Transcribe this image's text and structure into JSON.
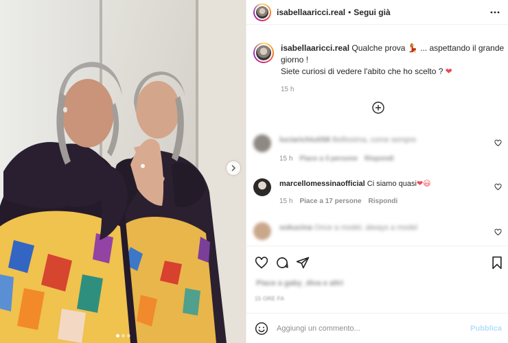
{
  "header": {
    "username": "isabellaaricci.real",
    "separator": "•",
    "follow_label": "Segui già",
    "more_icon": "more-horizontal-icon"
  },
  "caption": {
    "username": "isabellaaricci.real",
    "text_before_emoji": "Qualche prova",
    "emoji": "💃",
    "text_after_emoji": "... aspettando il grande giorno !",
    "line2": "Siete curiosi di vedere l'abito che ho scelto ?",
    "heart": "❤",
    "time": "15 h"
  },
  "load_more_icon": "plus-circle-icon",
  "comments": [
    {
      "username": "luciarichiuti58",
      "text": "Bellissima, come sempre",
      "time": "15 h",
      "likes": "Piace a 3 persone",
      "reply": "Rispondi",
      "blurred": true
    },
    {
      "username": "marcellomessinaofficial",
      "text": "Ci siamo quasi",
      "emoji": "❤😃",
      "time": "15 h",
      "likes": "Piace a 17 persone",
      "reply": "Rispondi",
      "blurred": false
    },
    {
      "username": "sokucina",
      "text": "Once a model, always a model",
      "blurred": true
    }
  ],
  "likes_text": "Piace a gaby_diva e altri",
  "posted": "15 ORE FA",
  "composer": {
    "placeholder": "Aggiungi un commento...",
    "publish_label": "Pubblica"
  },
  "colors": {
    "text": "#262626",
    "muted": "#8e8e8e",
    "heart_red": "#ed4956",
    "publish_disabled": "#b2dffc"
  }
}
